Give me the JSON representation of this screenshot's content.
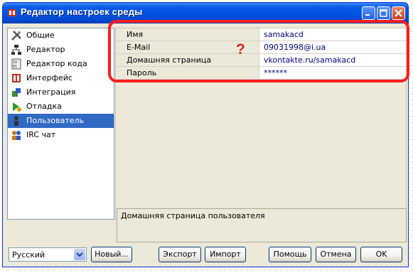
{
  "window": {
    "title": "Редактор настроек среды"
  },
  "tree": {
    "items": [
      {
        "label": "Общие",
        "icon": "tools-icon",
        "selected": false
      },
      {
        "label": "Редактор",
        "icon": "editor-tree-icon",
        "selected": false
      },
      {
        "label": "Редактор кода",
        "icon": "code-editor-icon",
        "selected": false
      },
      {
        "label": "Интерфейс",
        "icon": "interface-icon",
        "selected": false
      },
      {
        "label": "Интеграция",
        "icon": "integration-icon",
        "selected": false
      },
      {
        "label": "Отладка",
        "icon": "debug-icon",
        "selected": false
      },
      {
        "label": "Пользователь",
        "icon": "user-icon",
        "selected": true
      },
      {
        "label": "IRC чат",
        "icon": "irc-chat-icon",
        "selected": false
      }
    ]
  },
  "properties": [
    {
      "key": "Имя",
      "value": "samakacd"
    },
    {
      "key": "E-Mail",
      "value": "09031998@i.ua"
    },
    {
      "key": "Домашняя страница",
      "value": "vkontakte.ru/samakacd"
    },
    {
      "key": "Пароль",
      "value": "******"
    }
  ],
  "description": "Домашняя страница пользователя",
  "annotation": {
    "mark": "?",
    "color": "#ff1c1c"
  },
  "footer": {
    "language": "Русский",
    "new_label": "Новый...",
    "export_label": "Экспорт",
    "import_label": "Импорт",
    "help_label": "Помощь",
    "cancel_label": "Отмена",
    "ok_label": "OK"
  },
  "colors": {
    "title_bar": "#0054e3",
    "selection": "#316ac5",
    "value_text": "#000080"
  }
}
